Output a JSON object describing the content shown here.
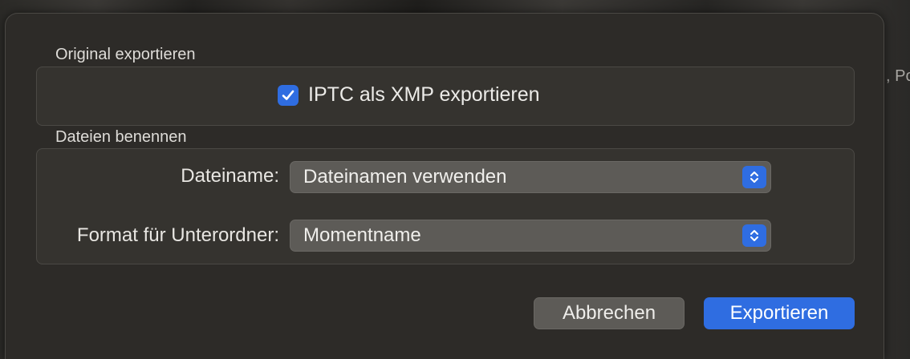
{
  "background": {
    "peek_text": ", Po"
  },
  "sections": {
    "original": {
      "title": "Original exportieren",
      "checkbox": {
        "label": "IPTC als XMP exportieren",
        "checked": true
      }
    },
    "naming": {
      "title": "Dateien benennen",
      "filename": {
        "label": "Dateiname:",
        "value": "Dateinamen verwenden"
      },
      "subfolder": {
        "label": "Format für Unterordner:",
        "value": "Momentname"
      }
    }
  },
  "buttons": {
    "cancel_label": "Abbrechen",
    "export_label": "Exportieren"
  },
  "colors": {
    "accent": "#2f6de1",
    "dialog_bg": "#2d2b28",
    "box_bg": "#35332f",
    "control_bg": "#5d5b57"
  },
  "icons": {
    "checkmark": "checkmark-icon",
    "stepper": "chevron-up-down-icon"
  }
}
